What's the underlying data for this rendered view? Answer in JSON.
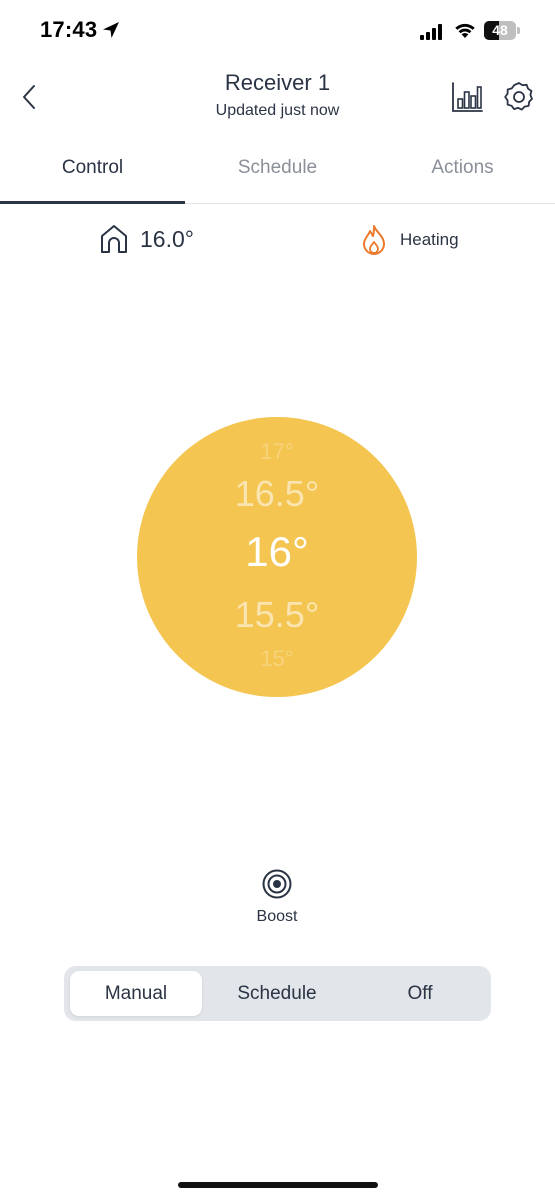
{
  "status_bar": {
    "time": "17:43",
    "battery_level": "48",
    "battery_fraction": 0.48
  },
  "header": {
    "title": "Receiver 1",
    "subtitle": "Updated just now",
    "back_icon": "chevron-left-icon",
    "stats_icon": "bar-chart-icon",
    "settings_icon": "gear-icon"
  },
  "tabs": [
    {
      "label": "Control",
      "active": true
    },
    {
      "label": "Schedule",
      "active": false
    },
    {
      "label": "Actions",
      "active": false
    }
  ],
  "status_row": {
    "current_temp": "16.0°",
    "heating_label": "Heating"
  },
  "dial": {
    "color": "#f4c550",
    "values": [
      "17°",
      "16.5°",
      "16°",
      "15.5°",
      "15°"
    ],
    "selected": "16°"
  },
  "boost": {
    "label": "Boost"
  },
  "mode": {
    "options": [
      "Manual",
      "Schedule",
      "Off"
    ],
    "selected": "Manual"
  },
  "colors": {
    "text": "#2b3445",
    "accent_flame": "#ec7a2c",
    "dial": "#f4c550"
  }
}
